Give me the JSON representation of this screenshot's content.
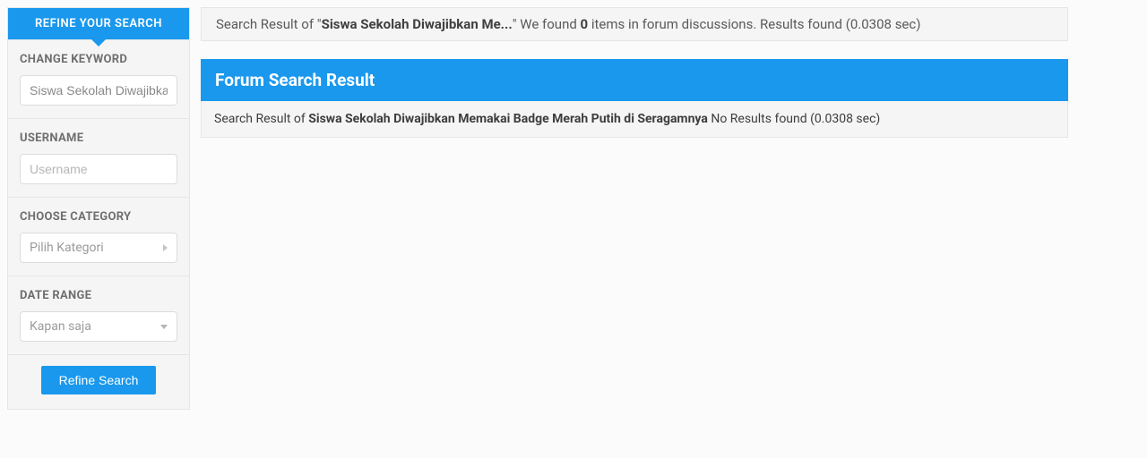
{
  "sidebar": {
    "header": "REFINE YOUR SEARCH",
    "keyword": {
      "label": "CHANGE KEYWORD",
      "value": "Siswa Sekolah Diwajibkan Memakai Badge Merah Putih di Seragamnya"
    },
    "username": {
      "label": "USERNAME",
      "placeholder": "Username"
    },
    "category": {
      "label": "CHOOSE CATEGORY",
      "selected": "Pilih Kategori"
    },
    "daterange": {
      "label": "DATE RANGE",
      "selected": "Kapan saja"
    },
    "submit_label": "Refine Search"
  },
  "summary": {
    "prefix": "Search Result of \"",
    "term_short": "Siswa Sekolah Diwajibkan Me...",
    "mid": "\" We found ",
    "count": "0",
    "suffix": " items in forum discussions. Results found (0.0308 sec)"
  },
  "forum": {
    "header": "Forum Search Result",
    "body_prefix": "Search Result of ",
    "term_full": "Siswa Sekolah Diwajibkan Memakai Badge Merah Putih di Seragamnya",
    "body_suffix": " No Results found (0.0308 sec)"
  }
}
